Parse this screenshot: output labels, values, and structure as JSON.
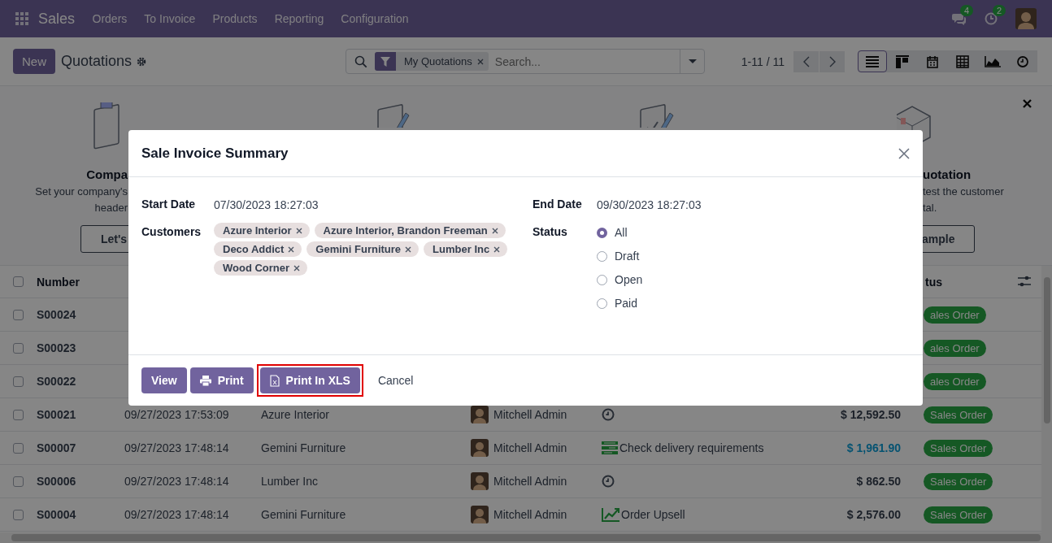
{
  "navbar": {
    "app": "Sales",
    "menu": [
      "Orders",
      "To Invoice",
      "Products",
      "Reporting",
      "Configuration"
    ],
    "messages_count": "4",
    "activities_count": "2"
  },
  "control_panel": {
    "new_button": "New",
    "title": "Quotations",
    "facet": "My Quotations",
    "search_placeholder": "Search...",
    "pager": "1-11 / 11",
    "views": [
      {
        "kind": "list",
        "selected": true
      },
      {
        "kind": "kanban",
        "selected": false
      },
      {
        "kind": "calendar",
        "selected": false
      },
      {
        "kind": "pivot",
        "selected": false
      },
      {
        "kind": "graph",
        "selected": false
      },
      {
        "kind": "activity",
        "selected": false
      }
    ]
  },
  "helper": {
    "cards": [
      {
        "kind": "clipboard",
        "title": "Compa",
        "lines": [
          "Set your company's",
          "header"
        ],
        "button": "Let's"
      },
      {
        "kind": "pen"
      },
      {
        "kind": "check"
      },
      {
        "kind": "box",
        "title": "uotation",
        "lines": [
          "test the customer",
          "tal."
        ],
        "button": "ample"
      }
    ]
  },
  "list": {
    "all_selected": false,
    "columns": [
      "Number",
      "tus"
    ],
    "rows": [
      {
        "selected": false,
        "number": "S00024",
        "status": "ales Order"
      },
      {
        "selected": false,
        "number": "S00023",
        "status": "ales Order"
      },
      {
        "selected": false,
        "number": "S00022",
        "status": "ales Order"
      },
      {
        "selected": false,
        "number": "S00021",
        "date": "09/27/2023 17:53:09",
        "customer": "Azure Interior",
        "salesperson": "Mitchell Admin",
        "activity": {
          "kind": "clock"
        },
        "total": "$ 12,592.50",
        "total_emphasis": false,
        "status": "Sales Order"
      },
      {
        "selected": false,
        "number": "S00007",
        "date": "09/27/2023 17:48:14",
        "customer": "Gemini Furniture",
        "salesperson": "Mitchell Admin",
        "activity": {
          "kind": "todo",
          "text": "Check delivery requirements"
        },
        "total": "$ 1,961.90",
        "total_emphasis": true,
        "status": "Sales Order"
      },
      {
        "selected": false,
        "number": "S00006",
        "date": "09/27/2023 17:48:14",
        "customer": "Lumber Inc",
        "salesperson": "Mitchell Admin",
        "activity": {
          "kind": "clock"
        },
        "total": "$ 862.50",
        "total_emphasis": false,
        "status": "Sales Order"
      },
      {
        "selected": false,
        "number": "S00004",
        "date": "09/27/2023 17:48:14",
        "customer": "Gemini Furniture",
        "salesperson": "Mitchell Admin",
        "activity": {
          "kind": "upsell",
          "text": "Order Upsell"
        },
        "total": "$ 2,576.00",
        "total_emphasis": false,
        "status": "Sales Order"
      }
    ]
  },
  "dialog": {
    "title": "Sale Invoice Summary",
    "start_date": {
      "label": "Start Date",
      "value": "07/30/2023 18:27:03"
    },
    "end_date": {
      "label": "End Date",
      "value": "09/30/2023 18:27:03"
    },
    "customers": {
      "label": "Customers",
      "tags": [
        "Azure Interior",
        "Azure Interior, Brandon Freeman",
        "Deco Addict",
        "Gemini Furniture",
        "Lumber Inc",
        "Wood Corner"
      ]
    },
    "status": {
      "label": "Status",
      "options": [
        {
          "label": "All",
          "selected": true
        },
        {
          "label": "Draft",
          "selected": false
        },
        {
          "label": "Open",
          "selected": false
        },
        {
          "label": "Paid",
          "selected": false
        }
      ]
    },
    "buttons": [
      {
        "kind": "primary",
        "label": "View",
        "highlighted": false
      },
      {
        "kind": "print",
        "label": "Print",
        "highlighted": false
      },
      {
        "kind": "xls",
        "label": "Print In XLS",
        "highlighted": true
      },
      {
        "kind": "link",
        "label": "Cancel",
        "highlighted": false
      }
    ]
  }
}
